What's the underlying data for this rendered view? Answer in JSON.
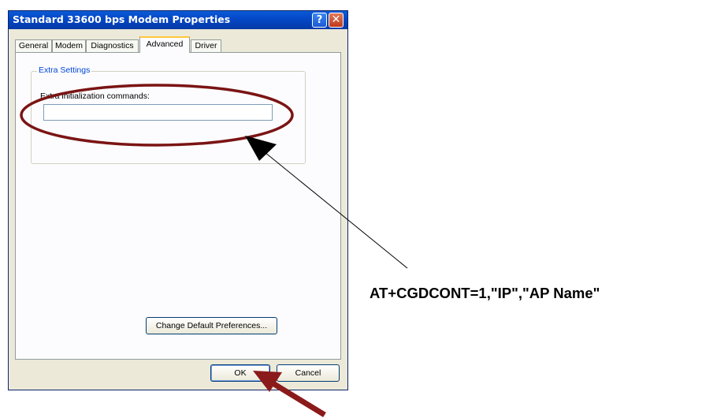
{
  "window": {
    "title": "Standard 33600 bps Modem Properties",
    "help_glyph": "?",
    "close_glyph": "✕"
  },
  "tabs": [
    {
      "label": "General"
    },
    {
      "label": "Modem"
    },
    {
      "label": "Diagnostics"
    },
    {
      "label": "Advanced",
      "active": true
    },
    {
      "label": "Driver"
    }
  ],
  "extra_settings": {
    "group_label": "Extra Settings",
    "field_label": "Extra initialization commands:",
    "field_value": ""
  },
  "buttons": {
    "change_prefs": "Change Default Preferences...",
    "ok": "OK",
    "cancel": "Cancel"
  },
  "annotation": {
    "callout_text": "AT+CGDCONT=1,\"IP\",\"AP Name\"",
    "ellipse_color": "#7b1414",
    "arrow_color": "#8b1a1a"
  }
}
